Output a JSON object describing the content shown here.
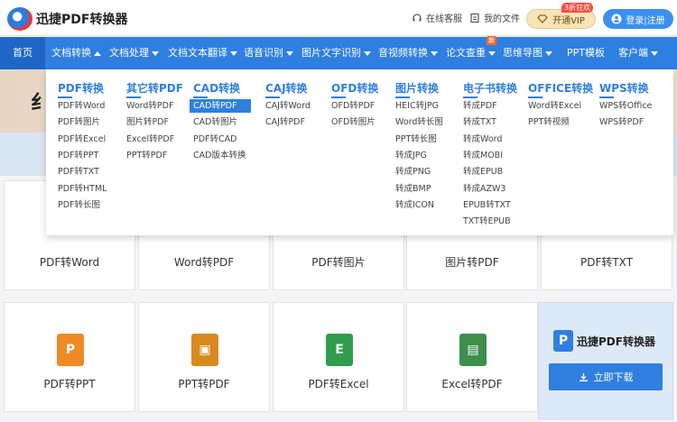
{
  "header": {
    "brand": "迅捷PDF转换器",
    "service": "在线客服",
    "files": "我的文件",
    "vip": "开通VIP",
    "vip_badge": "3折狂欢",
    "login": "登录|注册"
  },
  "nav": {
    "items": [
      {
        "label": "首页"
      },
      {
        "label": "文档转换"
      },
      {
        "label": "文档处理"
      },
      {
        "label": "文档文本翻译"
      },
      {
        "label": "语音识别"
      },
      {
        "label": "图片文字识别"
      },
      {
        "label": "音视频转换"
      },
      {
        "label": "论文查重"
      },
      {
        "label": "思维导图"
      },
      {
        "label": "PPT模板"
      },
      {
        "label": "客户端"
      }
    ],
    "new_badge": "新"
  },
  "banner": {
    "partial_char": "纟"
  },
  "dropdown": {
    "columns": [
      {
        "title": "PDF转换",
        "items": [
          "PDF转Word",
          "PDF转图片",
          "PDF转Excel",
          "PDF转PPT",
          "PDF转TXT",
          "PDF转HTML",
          "PDF转长图"
        ]
      },
      {
        "title": "其它转PDF",
        "items": [
          "Word转PDF",
          "图片转PDF",
          "Excel转PDF",
          "PPT转PDF"
        ]
      },
      {
        "title": "CAD转换",
        "items": [
          "CAD转PDF",
          "CAD转图片",
          "PDF转CAD",
          "CAD版本转换"
        ]
      },
      {
        "title": "CAJ转换",
        "items": [
          "CAJ转Word",
          "CAJ转PDF"
        ]
      },
      {
        "title": "OFD转换",
        "items": [
          "OFD转PDF",
          "OFD转图片"
        ]
      },
      {
        "title": "图片转换",
        "items": [
          "HEIC转JPG",
          "Word转长图",
          "PPT转长图",
          "转成JPG",
          "转成PNG",
          "转成BMP",
          "转成ICON"
        ]
      },
      {
        "title": "电子书转换",
        "items": [
          "转成PDF",
          "转成TXT",
          "转成Word",
          "转成MOBI",
          "转成EPUB",
          "转成AZW3",
          "EPUB转TXT",
          "TXT转EPUB"
        ]
      },
      {
        "title": "OFFICE转换",
        "items": [
          "Word转Excel",
          "PPT转视频"
        ]
      },
      {
        "title": "WPS转换",
        "items": [
          "WPS转Office",
          "WPS转PDF"
        ]
      }
    ]
  },
  "cards": {
    "row1": [
      "PDF转Word",
      "Word转PDF",
      "PDF转图片",
      "图片转PDF",
      "PDF转TXT"
    ],
    "row2": [
      "PDF转PPT",
      "PPT转PDF",
      "PDF转Excel",
      "Excel转PDF"
    ],
    "row2_icons": [
      "P",
      "▣",
      "E",
      "▤"
    ]
  },
  "download": {
    "name": "迅捷PDF转换器",
    "button": "立即下载"
  },
  "colors": {
    "primary": "#2f7fe0",
    "nav_home": "#1f67c6",
    "vip_gold": "#f7e4b8",
    "badge_red": "#ff4b3e"
  }
}
